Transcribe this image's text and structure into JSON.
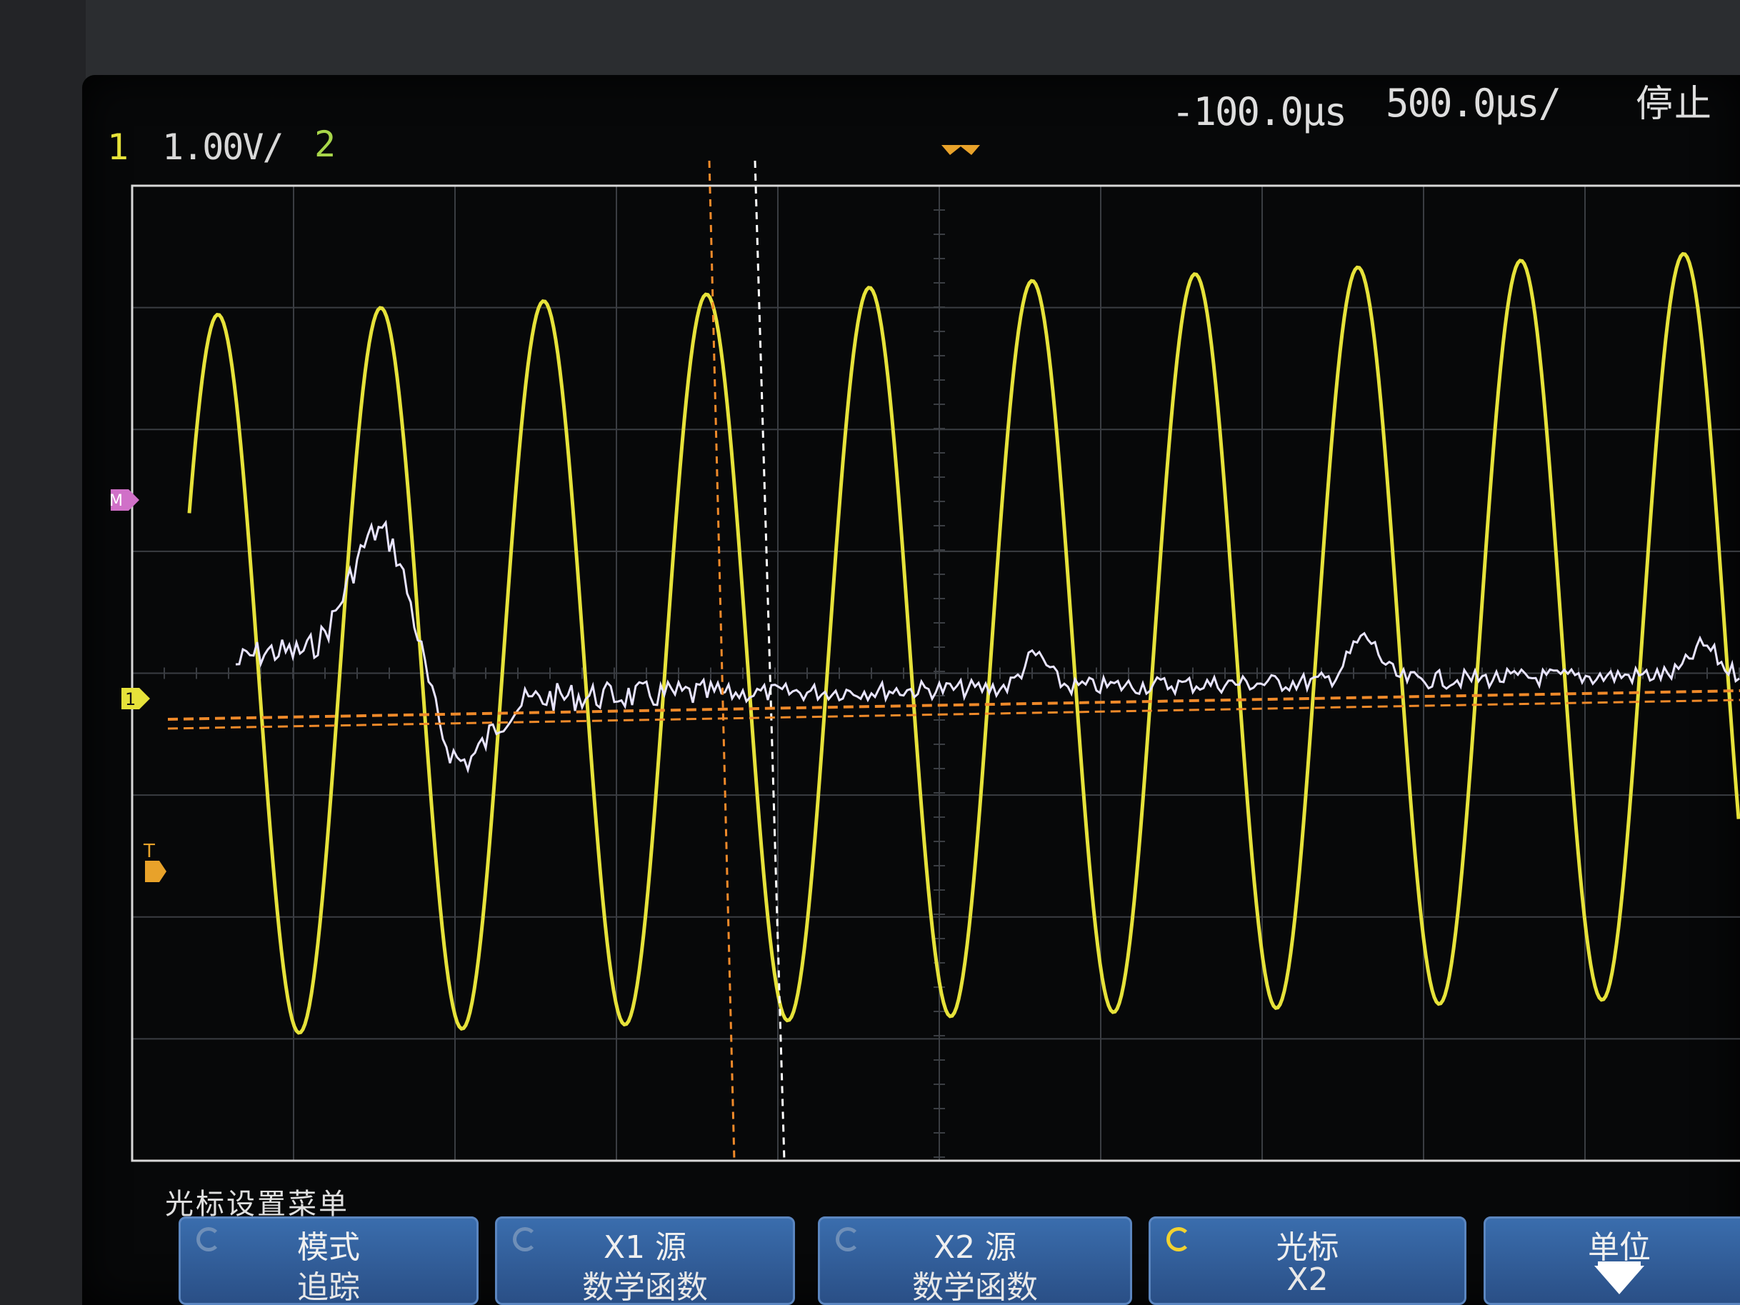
{
  "status": {
    "ch1_num": "1",
    "ch1_scale": "1.00V/",
    "ch2_num": "2",
    "time_delay": "-100.0µs",
    "time_scale": "500.0µs/",
    "run_state": "停止"
  },
  "markers": {
    "math": "M",
    "ch1": "1",
    "trigger": "T"
  },
  "softkey_menu": {
    "title": "光标设置菜单",
    "keys": [
      {
        "top": "模式",
        "bottom": "追踪"
      },
      {
        "top": "X1 源",
        "bottom": "数学函数"
      },
      {
        "top": "X2 源",
        "bottom": "数学函数"
      },
      {
        "top": "光标",
        "bottom": "X2"
      },
      {
        "top": "单位",
        "bottom": ""
      }
    ]
  },
  "colors": {
    "ch1": "#e6e23a",
    "ch2": "#a8d64a",
    "math": "#e8e4ff",
    "cursor_x1": "#f08a2a",
    "cursor_x2": "#ffffff",
    "softkey": "#2f5c99"
  },
  "icons": {
    "cursor_knob": "rotate-arrow-icon",
    "units_arrow": "down-arrow-icon"
  }
}
